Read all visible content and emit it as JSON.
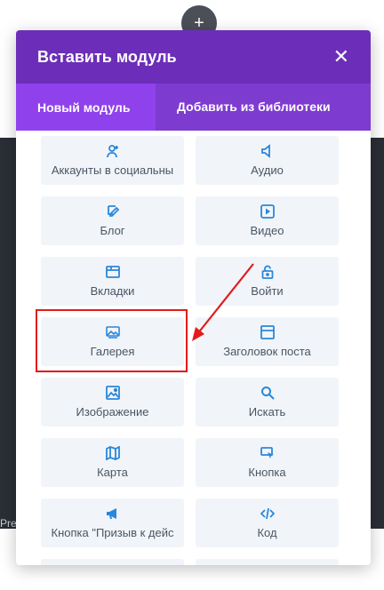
{
  "background": {
    "partial_text": "Pre"
  },
  "add_button": {
    "symbol": "+"
  },
  "modal": {
    "title": "Вставить модуль",
    "close_symbol": "✕",
    "tabs": [
      {
        "label": "Новый модуль",
        "active": true
      },
      {
        "label": "Добавить из библиотеки",
        "active": false
      }
    ],
    "modules": [
      {
        "label": "Аккаунты в социальны",
        "icon": "user-plus-icon"
      },
      {
        "label": "Аудио",
        "icon": "speaker-icon"
      },
      {
        "label": "Блог",
        "icon": "blog-icon"
      },
      {
        "label": "Видео",
        "icon": "video-icon"
      },
      {
        "label": "Вкладки",
        "icon": "tabs-icon"
      },
      {
        "label": "Войти",
        "icon": "lock-icon"
      },
      {
        "label": "Галерея",
        "icon": "gallery-icon"
      },
      {
        "label": "Заголовок поста",
        "icon": "post-title-icon"
      },
      {
        "label": "Изображение",
        "icon": "image-icon"
      },
      {
        "label": "Искать",
        "icon": "search-icon"
      },
      {
        "label": "Карта",
        "icon": "map-icon"
      },
      {
        "label": "Кнопка",
        "icon": "button-cursor-icon"
      },
      {
        "label": "Кнопка \"Призыв к дейс",
        "icon": "megaphone-icon"
      },
      {
        "label": "Код",
        "icon": "code-icon"
      }
    ]
  },
  "colors": {
    "header": "#6c2eb9",
    "tab_active": "#8f42ec",
    "icon": "#2b87da",
    "highlight": "#e21b1b"
  }
}
